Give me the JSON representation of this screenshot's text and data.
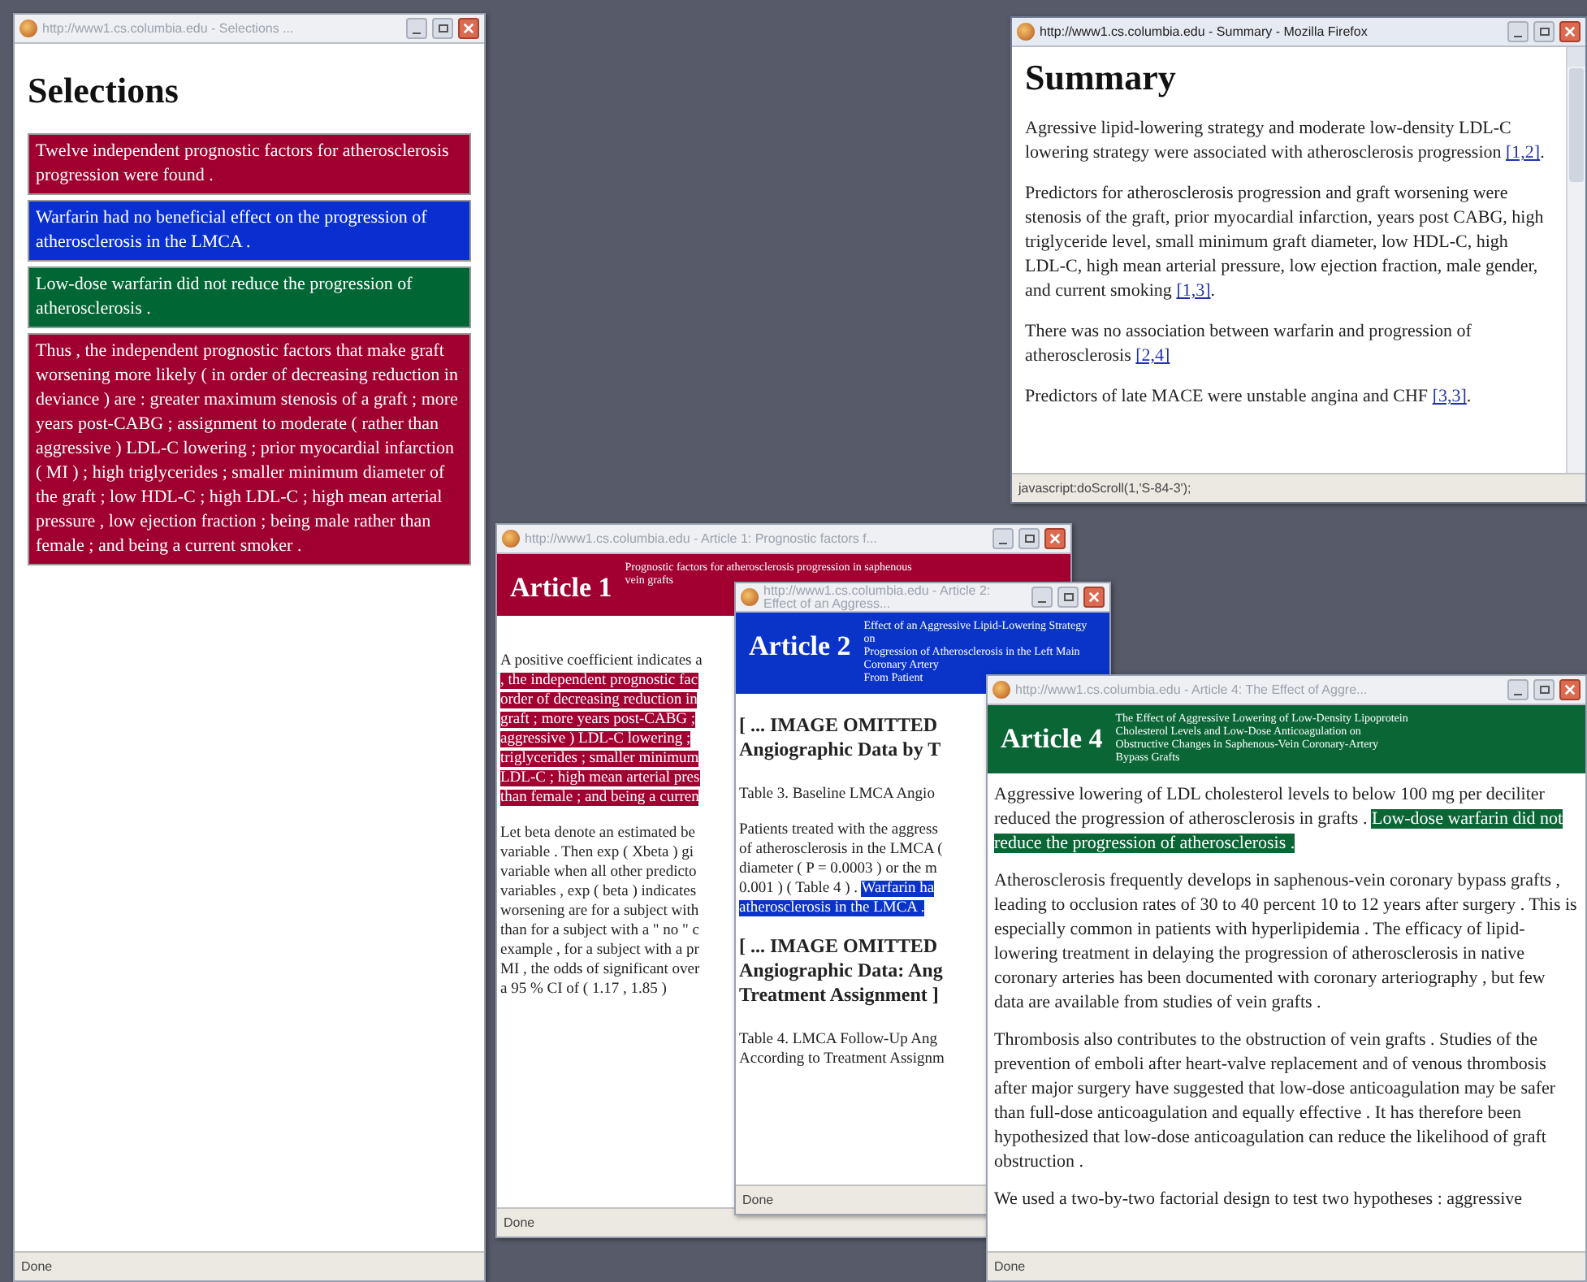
{
  "windows": [
    {
      "kind": "selections",
      "title": "http://www1.cs.columbia.edu - Selections ...",
      "active": false,
      "heading": "Selections",
      "status": "Done",
      "items": [
        {
          "text": "Twelve independent prognostic factors for atherosclerosis progression were found .",
          "color": "#a0002f"
        },
        {
          "text": "Warfarin had no beneficial effect on the progression of atherosclerosis in the LMCA .",
          "color": "#0a2fd0"
        },
        {
          "text": "Low-dose warfarin did not reduce the progression of atherosclerosis .",
          "color": "#006633"
        },
        {
          "text": "Thus , the independent prognostic factors that make graft worsening more likely ( in order of decreasing reduction in deviance ) are : greater maximum stenosis of a graft ; more years post-CABG ; assignment to moderate ( rather than aggressive ) LDL-C lowering ; prior myocardial infarction ( MI ) ; high triglycerides ; smaller minimum diameter of the graft ; low HDL-C ; high LDL-C ; high mean arterial pressure , low ejection fraction ; being male rather than female ; and being a current smoker .",
          "color": "#a0002f"
        }
      ]
    },
    {
      "kind": "summary",
      "title": "http://www1.cs.columbia.edu - Summary - Mozilla Firefox",
      "active": true,
      "heading": "Summary",
      "status": "javascript:doScroll(1,'S-84-3');",
      "paragraphs": [
        {
          "spans": [
            {
              "text": "Agressive lipid-lowering strategy and moderate low-density LDL-C lowering strategy were associated with atherosclerosis progression ",
              "link": false
            },
            {
              "text": "[1,2]",
              "link": true
            },
            {
              "text": ".",
              "link": false
            }
          ]
        },
        {
          "spans": [
            {
              "text": "Predictors for atherosclerosis progression and graft worsening were stenosis of the graft, prior myocardial infarction, years post CABG, high triglyceride level, small minimum graft diameter, low HDL-C, high LDL-C, high mean arterial pressure, low ejection fraction, male gender, and current smoking ",
              "link": false
            },
            {
              "text": "[1,3]",
              "link": true
            },
            {
              "text": ".",
              "link": false
            }
          ]
        },
        {
          "spans": [
            {
              "text": "There was no association between warfarin and progression of atherosclerosis ",
              "link": false
            },
            {
              "text": "[2,4]",
              "link": true
            }
          ]
        },
        {
          "spans": [
            {
              "text": "Predictors of late MACE were unstable angina and CHF ",
              "link": false
            },
            {
              "text": "[3,3]",
              "link": true
            },
            {
              "text": ".",
              "link": false
            }
          ]
        }
      ]
    },
    {
      "kind": "article",
      "title": "http://www1.cs.columbia.edu - Article 1: Prognostic factors f...",
      "active": false,
      "color": "#a10031",
      "label": "Article 1",
      "subtitle_lines": [
        "Prognostic factors for atherosclerosis progression in saphenous",
        "vein grafts"
      ],
      "status": "Done",
      "body": [
        {
          "kind": "lines",
          "lines": [
            [
              {
                "text": "A positive coefficient indicates a",
                "highlighted": false
              }
            ],
            [
              {
                "text": ", the independent prognostic fac",
                "highlighted": true
              }
            ],
            [
              {
                "text": "order of decreasing reduction in",
                "highlighted": true
              }
            ],
            [
              {
                "text": "graft ; more years post-CABG ;",
                "highlighted": true
              }
            ],
            [
              {
                "text": "aggressive ) LDL-C lowering ;",
                "highlighted": true
              }
            ],
            [
              {
                "text": "triglycerides ; smaller minimum",
                "highlighted": true
              }
            ],
            [
              {
                "text": "LDL-C ; high mean arterial pres",
                "highlighted": true
              }
            ],
            [
              {
                "text": "than female ; and being a curren",
                "highlighted": true
              }
            ]
          ]
        },
        {
          "kind": "lines",
          "lines": [
            [
              {
                "text": "Let beta denote an estimated be",
                "highlighted": false
              }
            ],
            [
              {
                "text": "variable . Then exp ( Xbeta ) gi",
                "highlighted": false
              }
            ],
            [
              {
                "text": "variable when all other predicto",
                "highlighted": false
              }
            ],
            [
              {
                "text": "variables , exp ( beta ) indicates",
                "highlighted": false
              }
            ],
            [
              {
                "text": "worsening are for a subject with",
                "highlighted": false
              }
            ],
            [
              {
                "text": "than for a subject with a \" no \" c",
                "highlighted": false
              }
            ],
            [
              {
                "text": "example , for a subject with a pr",
                "highlighted": false
              }
            ],
            [
              {
                "text": "MI , the odds of significant over",
                "highlighted": false
              }
            ],
            [
              {
                "text": "a 95 % CI of ( 1.17 , 1.85 )",
                "highlighted": false
              }
            ]
          ]
        }
      ]
    },
    {
      "kind": "article",
      "title": "http://www1.cs.columbia.edu - Article 2: Effect of an Aggress...",
      "active": false,
      "color": "#0a33c8",
      "label": "Article 2",
      "subtitle_lines": [
        "Effect of an Aggressive Lipid-Lowering Strategy on",
        "Progression of Atherosclerosis in the Left Main Coronary Artery",
        "From Patient"
      ],
      "status": "Done",
      "body": [
        {
          "kind": "heading",
          "lines": [
            [
              {
                "text": "[ ... IMAGE OMITTED",
                "highlighted": false
              }
            ],
            [
              {
                "text": "Angiographic Data by T",
                "highlighted": false
              }
            ]
          ]
        },
        {
          "kind": "lines",
          "lines": [
            [
              {
                "text": "Table 3. Baseline LMCA Angio",
                "highlighted": false
              }
            ]
          ]
        },
        {
          "kind": "lines",
          "lines": [
            [
              {
                "text": "Patients treated with the aggress",
                "highlighted": false
              }
            ],
            [
              {
                "text": "of atherosclerosis in the LMCA (",
                "highlighted": false
              }
            ],
            [
              {
                "text": "diameter ( P = 0.0003 ) or the m",
                "highlighted": false
              }
            ],
            [
              {
                "text": "0.001 ) ( Table 4 ) . ",
                "highlighted": false
              },
              {
                "text": "Warfarin ha",
                "highlighted": true
              }
            ],
            [
              {
                "text": "atherosclerosis in the LMCA .",
                "highlighted": true
              }
            ]
          ]
        },
        {
          "kind": "heading",
          "lines": [
            [
              {
                "text": "[ ... IMAGE OMITTED",
                "highlighted": false
              }
            ],
            [
              {
                "text": "Angiographic Data: Ang",
                "highlighted": false
              }
            ],
            [
              {
                "text": "Treatment Assignment ]",
                "highlighted": false
              }
            ]
          ]
        },
        {
          "kind": "lines",
          "lines": [
            [
              {
                "text": "Table 4. LMCA Follow-Up Ang",
                "highlighted": false
              }
            ],
            [
              {
                "text": "According to Treatment Assignm",
                "highlighted": false
              }
            ]
          ]
        }
      ]
    },
    {
      "kind": "article",
      "title": "http://www1.cs.columbia.edu - Article 4: The Effect of Aggre...",
      "active": false,
      "color": "#0b6636",
      "label": "Article 4",
      "subtitle_lines": [
        "The Effect of Aggressive Lowering of Low-Density Lipoprotein",
        "Cholesterol Levels and Low-Dose Anticoagulation on",
        "Obstructive Changes in Saphenous-Vein Coronary-Artery",
        "Bypass Grafts"
      ],
      "status": "Done",
      "body": [
        {
          "kind": "para",
          "spans": [
            {
              "text": "Aggressive lowering of LDL cholesterol levels to below 100 mg per deciliter reduced the progression of atherosclerosis in grafts . ",
              "highlighted": false
            },
            {
              "text": "Low-dose warfarin did not reduce the progression of atherosclerosis .",
              "highlighted": true
            }
          ]
        },
        {
          "kind": "para",
          "spans": [
            {
              "text": "Atherosclerosis frequently develops in saphenous-vein coronary bypass grafts , leading to occlusion rates of 30 to 40 percent 10 to 12 years after surgery . This is especially common in patients with hyperlipidemia . The efficacy of lipid-lowering treatment in delaying the progression of atherosclerosis in native coronary arteries has been documented with coronary arteriography , but few data are available from studies of vein grafts .",
              "highlighted": false
            }
          ]
        },
        {
          "kind": "para",
          "spans": [
            {
              "text": "Thrombosis also contributes to the obstruction of vein grafts . Studies of the prevention of emboli after heart-valve replacement and of venous thrombosis after major surgery have suggested that low-dose anticoagulation may be safer than full-dose anticoagulation and equally effective . It has therefore been hypothesized that low-dose anticoagulation can reduce the likelihood of graft obstruction .",
              "highlighted": false
            }
          ]
        },
        {
          "kind": "lines",
          "lines": [
            [
              {
                "text": "We used a two-by-two factorial design to test two hypotheses : aggressive",
                "highlighted": false
              }
            ]
          ]
        }
      ]
    }
  ]
}
